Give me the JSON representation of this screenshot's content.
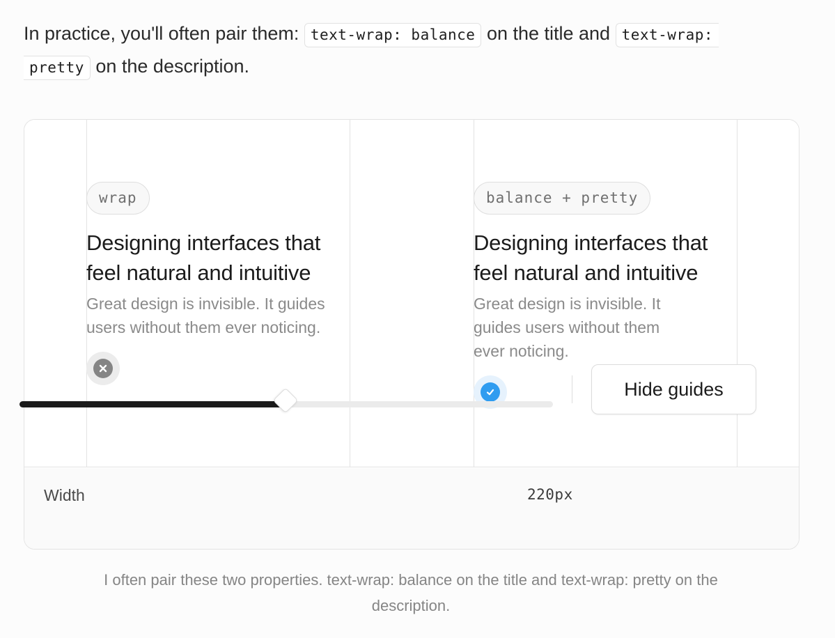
{
  "intro": {
    "prefix": "In practice, you'll often pair them: ",
    "code_balance": "text-wrap: balance",
    "middle": " on the title and ",
    "code_pretty_1": "text-wrap:",
    "code_pretty_2": "pretty",
    "suffix": " on the description."
  },
  "demo": {
    "left": {
      "label": "wrap",
      "title": "Designing interfaces that feel natural and intuitive",
      "description": "Great design is invisible. It guides users without them ever noticing.",
      "status_icon": "x-icon",
      "status_color": "#858585"
    },
    "right": {
      "label": "balance + pretty",
      "title_line1": "Designing interfaces that",
      "title_line2": "feel natural and intuitive",
      "desc_line1": "Great design is invisible. It",
      "desc_line2": "guides users without them",
      "desc_line3": "ever noticing.",
      "status_icon": "check-icon",
      "status_color": "#2f9cf0"
    }
  },
  "controls": {
    "width_label": "Width",
    "width_value": "220px",
    "slider_fraction": 0.5,
    "hide_guides_label": "Hide guides"
  },
  "caption": "I often pair these two properties. text-wrap: balance on the title and text-wrap: pretty on the description."
}
